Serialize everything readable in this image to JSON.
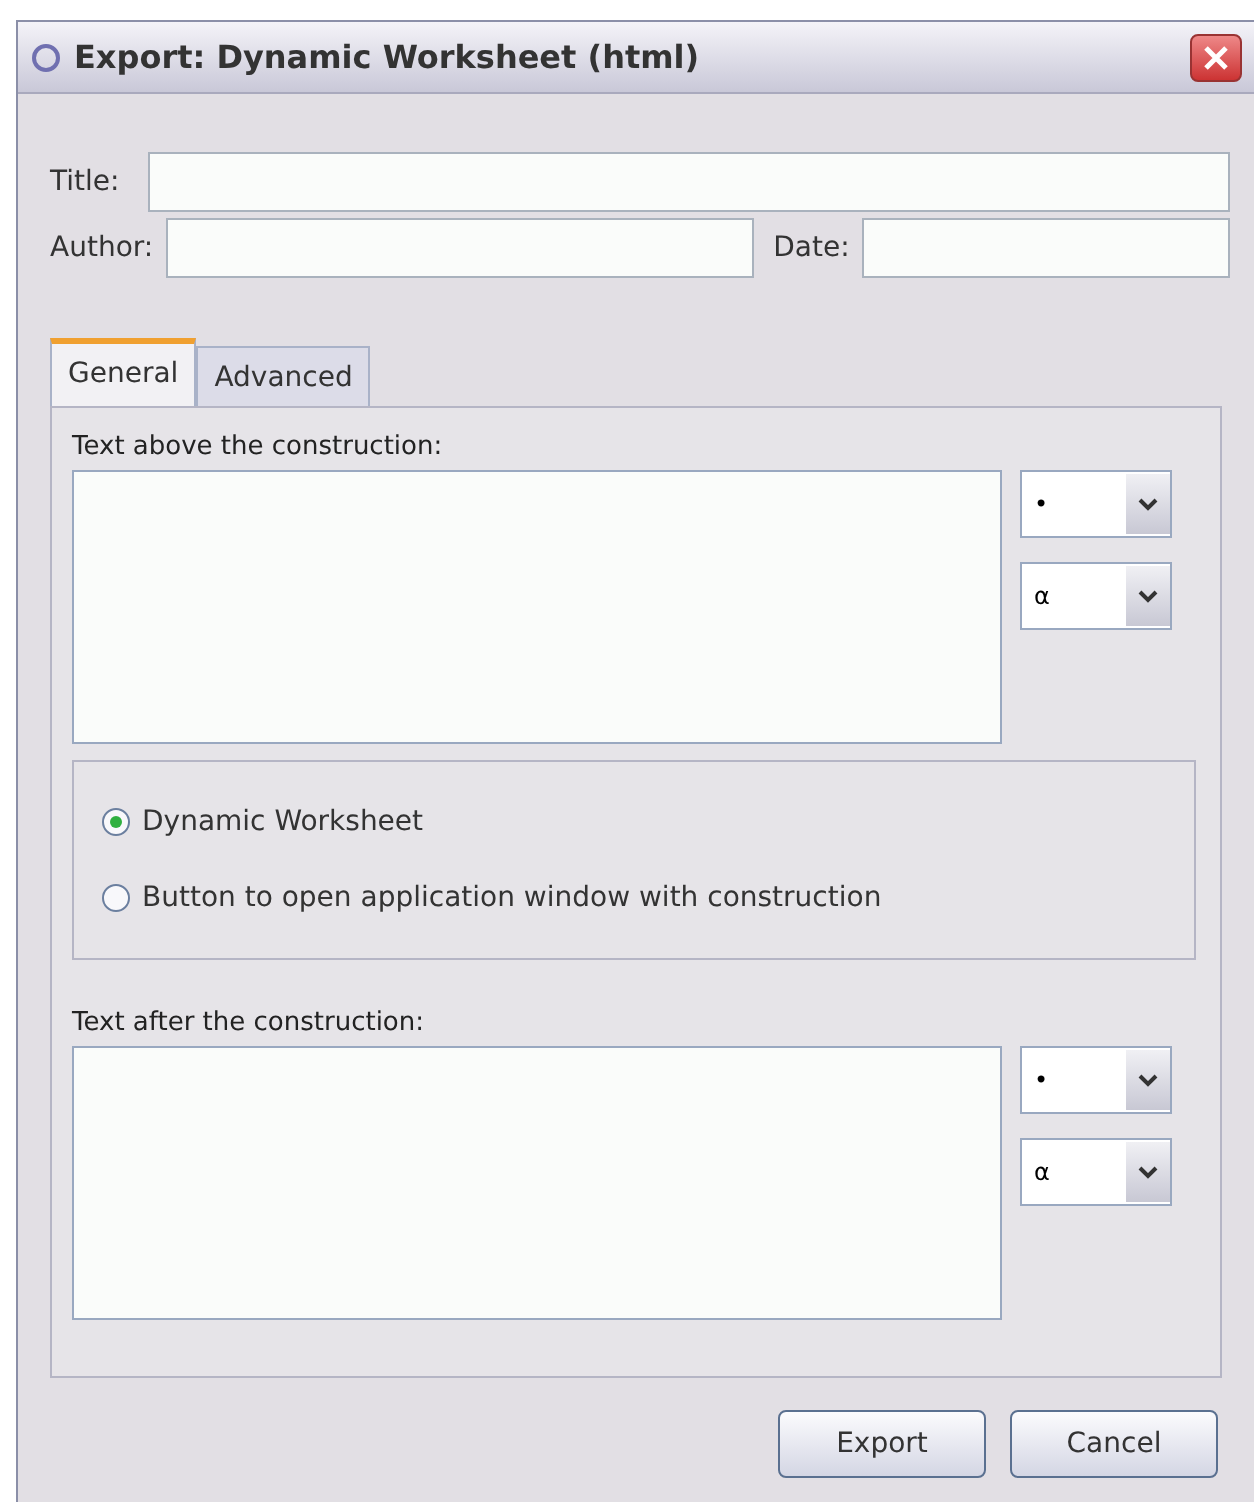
{
  "window": {
    "title": "Export: Dynamic Worksheet (html)"
  },
  "title_field": {
    "label": "Title:"
  },
  "author_field": {
    "label": "Author:"
  },
  "date_field": {
    "label": "Date:"
  },
  "tabs": [
    {
      "label": "General",
      "selected": true
    },
    {
      "label": "Advanced",
      "selected": false
    }
  ],
  "text_above": {
    "label": "Text above the construction:",
    "dropdowns": [
      "•",
      "α"
    ]
  },
  "options": [
    {
      "label": "Dynamic Worksheet",
      "selected": true
    },
    {
      "label": "Button to open application window with construction",
      "selected": false
    }
  ],
  "text_after": {
    "label": "Text after the construction:",
    "dropdowns": [
      "•",
      "α"
    ]
  },
  "buttons": [
    "Export",
    "Cancel"
  ]
}
